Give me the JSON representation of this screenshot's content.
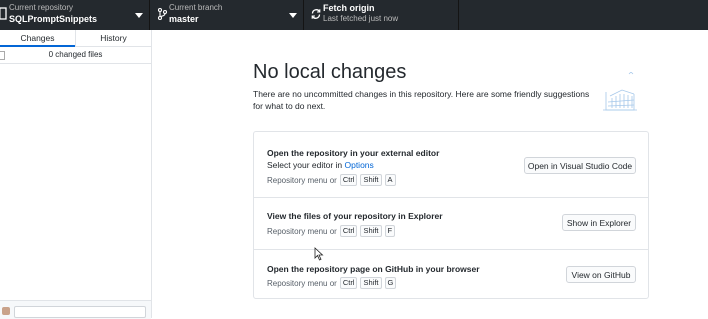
{
  "toolbar": {
    "repo": {
      "label": "Current repository",
      "value": "SQLPromptSnippets"
    },
    "branch": {
      "label": "Current branch",
      "value": "master"
    },
    "fetch": {
      "label": "Fetch origin",
      "sub": "Last fetched just now"
    }
  },
  "sidebar": {
    "tabs": [
      {
        "label": "Changes",
        "active": true
      },
      {
        "label": "History",
        "active": false
      }
    ],
    "changed_files": "0 changed files"
  },
  "main": {
    "title": "No local changes",
    "subtitle": "There are no uncommitted changes in this repository. Here are some friendly suggestions for what to do next.",
    "suggestions": [
      {
        "title": "Open the repository in your external editor",
        "line_prefix": "Select your editor in ",
        "line_link": "Options",
        "shortcut_prefix": "Repository menu or",
        "keys": [
          "Ctrl",
          "Shift",
          "A"
        ],
        "button": "Open in Visual Studio Code"
      },
      {
        "title": "View the files of your repository in Explorer",
        "shortcut_prefix": "Repository menu or",
        "keys": [
          "Ctrl",
          "Shift",
          "F"
        ],
        "button": "Show in Explorer"
      },
      {
        "title": "Open the repository page on GitHub in your browser",
        "shortcut_prefix": "Repository menu or",
        "keys": [
          "Ctrl",
          "Shift",
          "G"
        ],
        "button": "View on GitHub"
      }
    ]
  },
  "colors": {
    "toolbar": "#24292e",
    "accent": "#0366d6",
    "border": "#e1e4e8"
  }
}
